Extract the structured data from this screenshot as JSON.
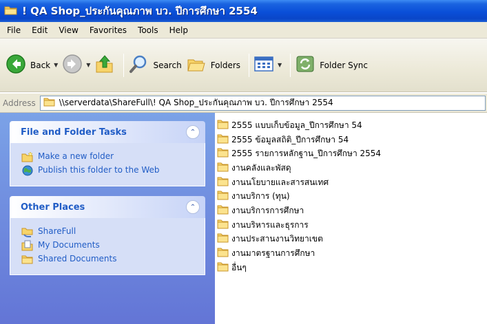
{
  "window": {
    "title": "! QA Shop_ประกันคุณภาพ บว. ปีการศึกษา 2554"
  },
  "menubar": {
    "items": [
      "File",
      "Edit",
      "View",
      "Favorites",
      "Tools",
      "Help"
    ]
  },
  "toolbar": {
    "back_label": "Back",
    "search_label": "Search",
    "folders_label": "Folders",
    "folder_sync_label": "Folder Sync"
  },
  "address": {
    "label": "Address",
    "value": "\\\\serverdata\\ShareFull\\! QA Shop_ประกันคุณภาพ บว. ปีการศึกษา 2554"
  },
  "taskpane": {
    "file_folder_tasks": {
      "title": "File and Folder Tasks",
      "items": [
        "Make a new folder",
        "Publish this folder to the Web"
      ]
    },
    "other_places": {
      "title": "Other Places",
      "items": [
        "ShareFull",
        "My Documents",
        "Shared Documents"
      ]
    }
  },
  "files": [
    "2555 แบบเก็บข้อมูล_ปีการศึกษา 54",
    "2555 ข้อมูลสถิติ_ปีการศึกษา 54",
    "2555 รายการหลักฐาน_ปีการศึกษา 2554",
    "งานคลังและพัสดุ",
    "งานนโยบายและสารสนเทศ",
    "งานบริการ (ทุน)",
    "งานบริการการศึกษา",
    "งานบริหารและธุรการ",
    "งานประสานงานวิทยาเขต",
    "งานมาตรฐานการศึกษา",
    "อื่นๆ"
  ],
  "colors": {
    "titlebar": "#0a4fd8",
    "taskpane_bg": "#6375d6",
    "panel_title": "#215dc6",
    "folder_yellow": "#f5c94a"
  }
}
